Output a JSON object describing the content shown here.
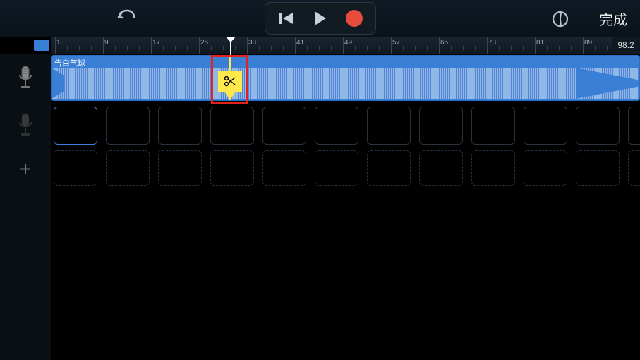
{
  "header": {
    "done_label": "完成"
  },
  "ruler": {
    "ticks": [
      1,
      9,
      17,
      25,
      33,
      41,
      49,
      57,
      65,
      73,
      81,
      89
    ],
    "counter": "98.2"
  },
  "track": {
    "region_title": "告白气球"
  },
  "scissors": {
    "icon_name": "scissors-icon"
  }
}
